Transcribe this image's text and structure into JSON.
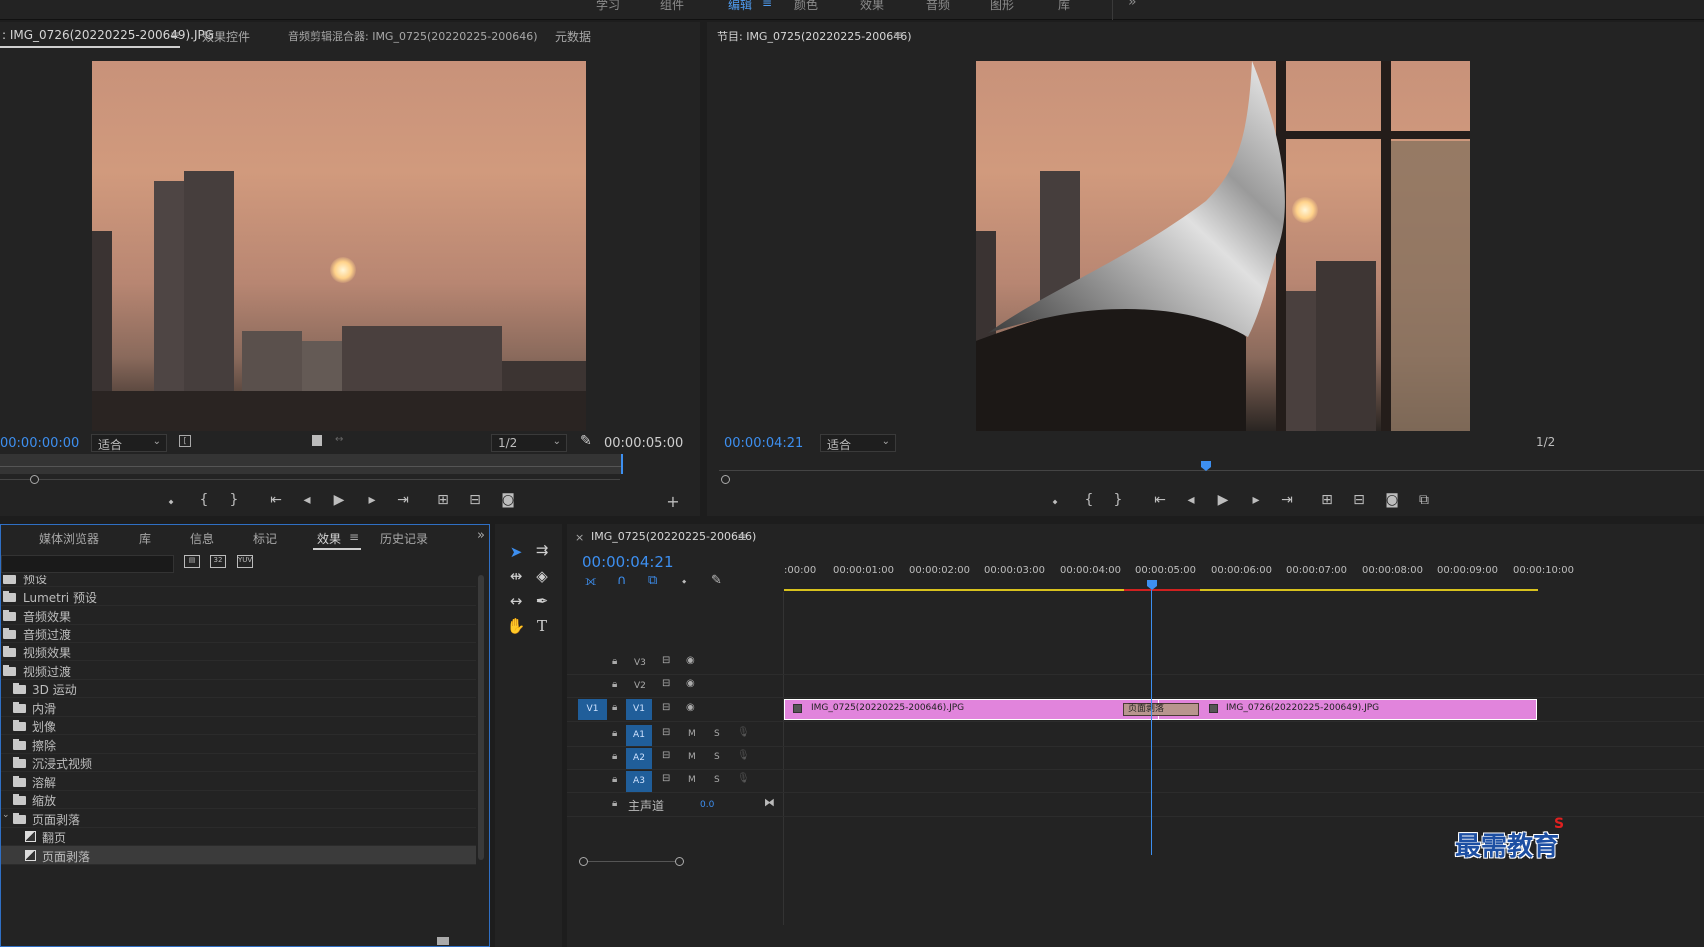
{
  "workspace_tabs": [
    "学习",
    "组件",
    "编辑",
    "颜色",
    "效果",
    "音频",
    "图形",
    "库"
  ],
  "workspace_active": "编辑",
  "source_panel": {
    "tabs": [
      ": IMG_0726(20220225-200649).JPG",
      "效果控件",
      "音频剪辑混合器: IMG_0725(20220225-200646)",
      "元数据"
    ],
    "timecode": "00:00:00:00",
    "fit": "适合",
    "resolution": "1/2",
    "duration": "00:00:05:00"
  },
  "program_panel": {
    "title": "节目: IMG_0725(20220225-200646)",
    "timecode": "00:00:04:21",
    "fit": "适合",
    "resolution": "1/2"
  },
  "project_panel": {
    "tabs": [
      "媒体浏览器",
      "库",
      "信息",
      "标记",
      "效果",
      "历史记录"
    ],
    "active_tab": "效果",
    "items": [
      {
        "label": "预设",
        "level": 0,
        "type": "folder"
      },
      {
        "label": "Lumetri 预设",
        "level": 0,
        "type": "folder"
      },
      {
        "label": "音频效果",
        "level": 0,
        "type": "folder"
      },
      {
        "label": "音频过渡",
        "level": 0,
        "type": "folder"
      },
      {
        "label": "视频效果",
        "level": 0,
        "type": "folder"
      },
      {
        "label": "视频过渡",
        "level": 0,
        "type": "folder"
      },
      {
        "label": "3D 运动",
        "level": 1,
        "type": "folder"
      },
      {
        "label": "内滑",
        "level": 1,
        "type": "folder"
      },
      {
        "label": "划像",
        "level": 1,
        "type": "folder"
      },
      {
        "label": "擦除",
        "level": 1,
        "type": "folder"
      },
      {
        "label": "沉浸式视频",
        "level": 1,
        "type": "folder"
      },
      {
        "label": "溶解",
        "level": 1,
        "type": "folder"
      },
      {
        "label": "缩放",
        "level": 1,
        "type": "folder"
      },
      {
        "label": "页面剥落",
        "level": 1,
        "type": "folder"
      },
      {
        "label": "翻页",
        "level": 2,
        "type": "effect"
      },
      {
        "label": "页面剥落",
        "level": 2,
        "type": "effect"
      }
    ]
  },
  "timeline": {
    "sequence_name": "IMG_0725(20220225-200646)",
    "timecode": "00:00:04:21",
    "ruler_ticks": [
      ":00:00",
      "00:00:01:00",
      "00:00:02:00",
      "00:00:03:00",
      "00:00:04:00",
      "00:00:05:00",
      "00:00:06:00",
      "00:00:07:00",
      "00:00:08:00",
      "00:00:09:00",
      "00:00:10:00"
    ],
    "tracks": {
      "video": [
        "V3",
        "V2",
        "V1"
      ],
      "audio": [
        "A1",
        "A2",
        "A3"
      ],
      "source_patch": "V1",
      "master_label": "主声道",
      "master_value": "0.0",
      "mute": "M",
      "solo": "S"
    },
    "clips": [
      {
        "name": "IMG_0725(20220225-200646).JPG"
      },
      {
        "name": "IMG_0726(20220225-200649).JPG"
      }
    ],
    "transition_label": "页面剥落"
  },
  "watermark": "最需教育"
}
